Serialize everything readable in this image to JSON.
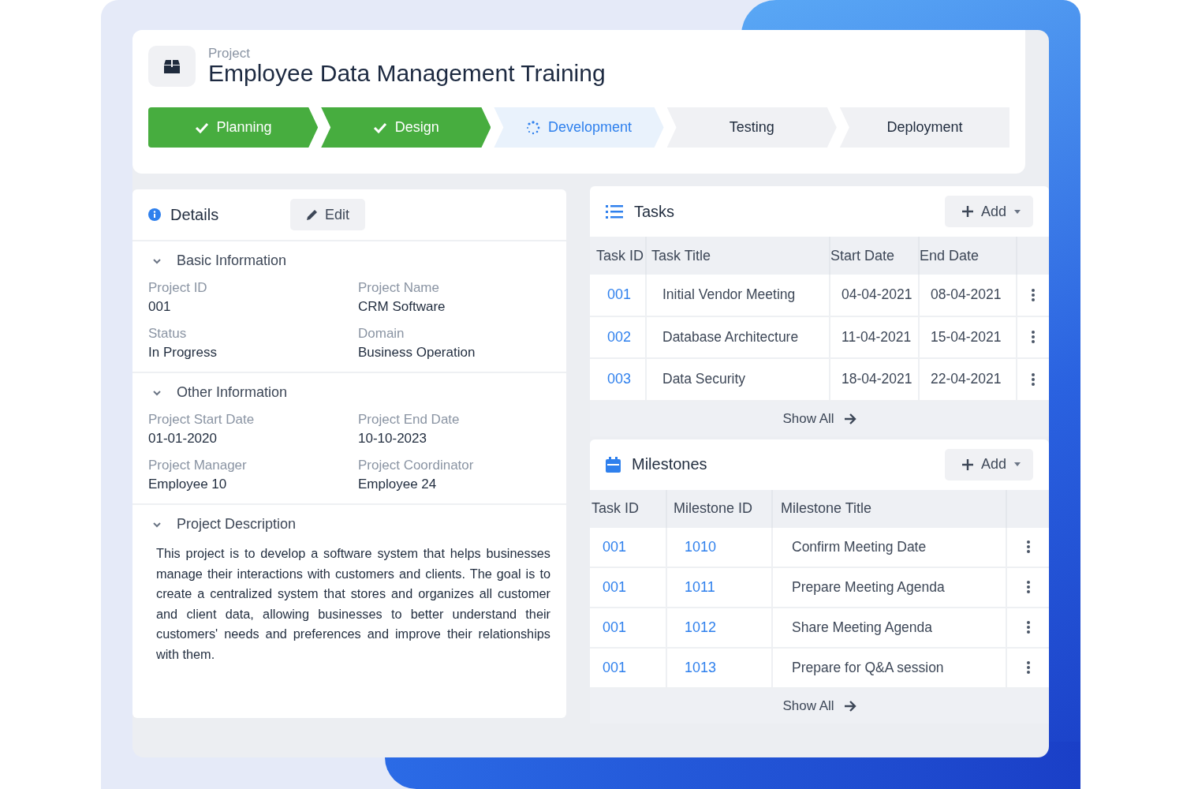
{
  "project": {
    "label": "Project",
    "title": "Employee Data Management Training"
  },
  "stages": [
    {
      "label": "Planning",
      "done": true,
      "selected": false
    },
    {
      "label": "Design",
      "done": true,
      "selected": false
    },
    {
      "label": "Development",
      "done": false,
      "selected": true
    },
    {
      "label": "Testing",
      "done": false,
      "selected": false
    },
    {
      "label": "Deployment",
      "done": false,
      "selected": false
    }
  ],
  "details": {
    "title": "Details",
    "edit_button": "Edit",
    "sections": [
      {
        "title": "Basic Information",
        "expanded": true,
        "fields": [
          {
            "label": "Project ID",
            "value": "001"
          },
          {
            "label": "Project Name",
            "value": "CRM Software"
          },
          {
            "label": "Status",
            "value": "In Progress"
          },
          {
            "label": "Domain",
            "value": "Business Operation"
          }
        ]
      },
      {
        "title": "Other Information",
        "expanded": true,
        "fields": [
          {
            "label": "Project Start Date",
            "value": "01-01-2020"
          },
          {
            "label": "Project End Date",
            "value": "10-10-2023"
          },
          {
            "label": "Project Manager",
            "value": "Employee 10"
          },
          {
            "label": "Project Coordinator",
            "value": "Employee 24"
          }
        ]
      },
      {
        "title": "Project Description",
        "expanded": true,
        "text": "This project is to develop a software system that helps businesses manage their interactions with customers and clients. The goal is to create a centralized system that stores and organizes all customer and client data, allowing businesses to better understand their customers' needs and preferences and improve their relationships with them."
      }
    ]
  },
  "tasks": {
    "title": "Tasks",
    "add_button": "Add",
    "show_all": "Show All",
    "columns": [
      {
        "label": "Task ID",
        "link": true
      },
      {
        "label": "Task Title",
        "link": false
      },
      {
        "label": "Start Date",
        "link": false
      },
      {
        "label": "End Date",
        "link": false
      }
    ],
    "rows": [
      [
        "001",
        "Initial Vendor Meeting",
        "04-04-2021",
        "08-04-2021"
      ],
      [
        "002",
        "Database Architecture",
        "11-04-2021",
        "15-04-2021"
      ],
      [
        "003",
        "Data Security",
        "18-04-2021",
        "22-04-2021"
      ]
    ]
  },
  "milestones": {
    "title": "Milestones",
    "add_button": "Add",
    "show_all": "Show All",
    "columns": [
      {
        "label": "Task ID",
        "link": true
      },
      {
        "label": "Milestone ID",
        "link": true
      },
      {
        "label": "Milestone Title",
        "link": false
      }
    ],
    "rows": [
      [
        "001",
        "1010",
        "Confirm Meeting Date"
      ],
      [
        "001",
        "1011",
        "Prepare Meeting Agenda"
      ],
      [
        "001",
        "1012",
        "Share Meeting Agenda"
      ],
      [
        "001",
        "1013",
        "Prepare for Q&A session"
      ]
    ]
  }
}
